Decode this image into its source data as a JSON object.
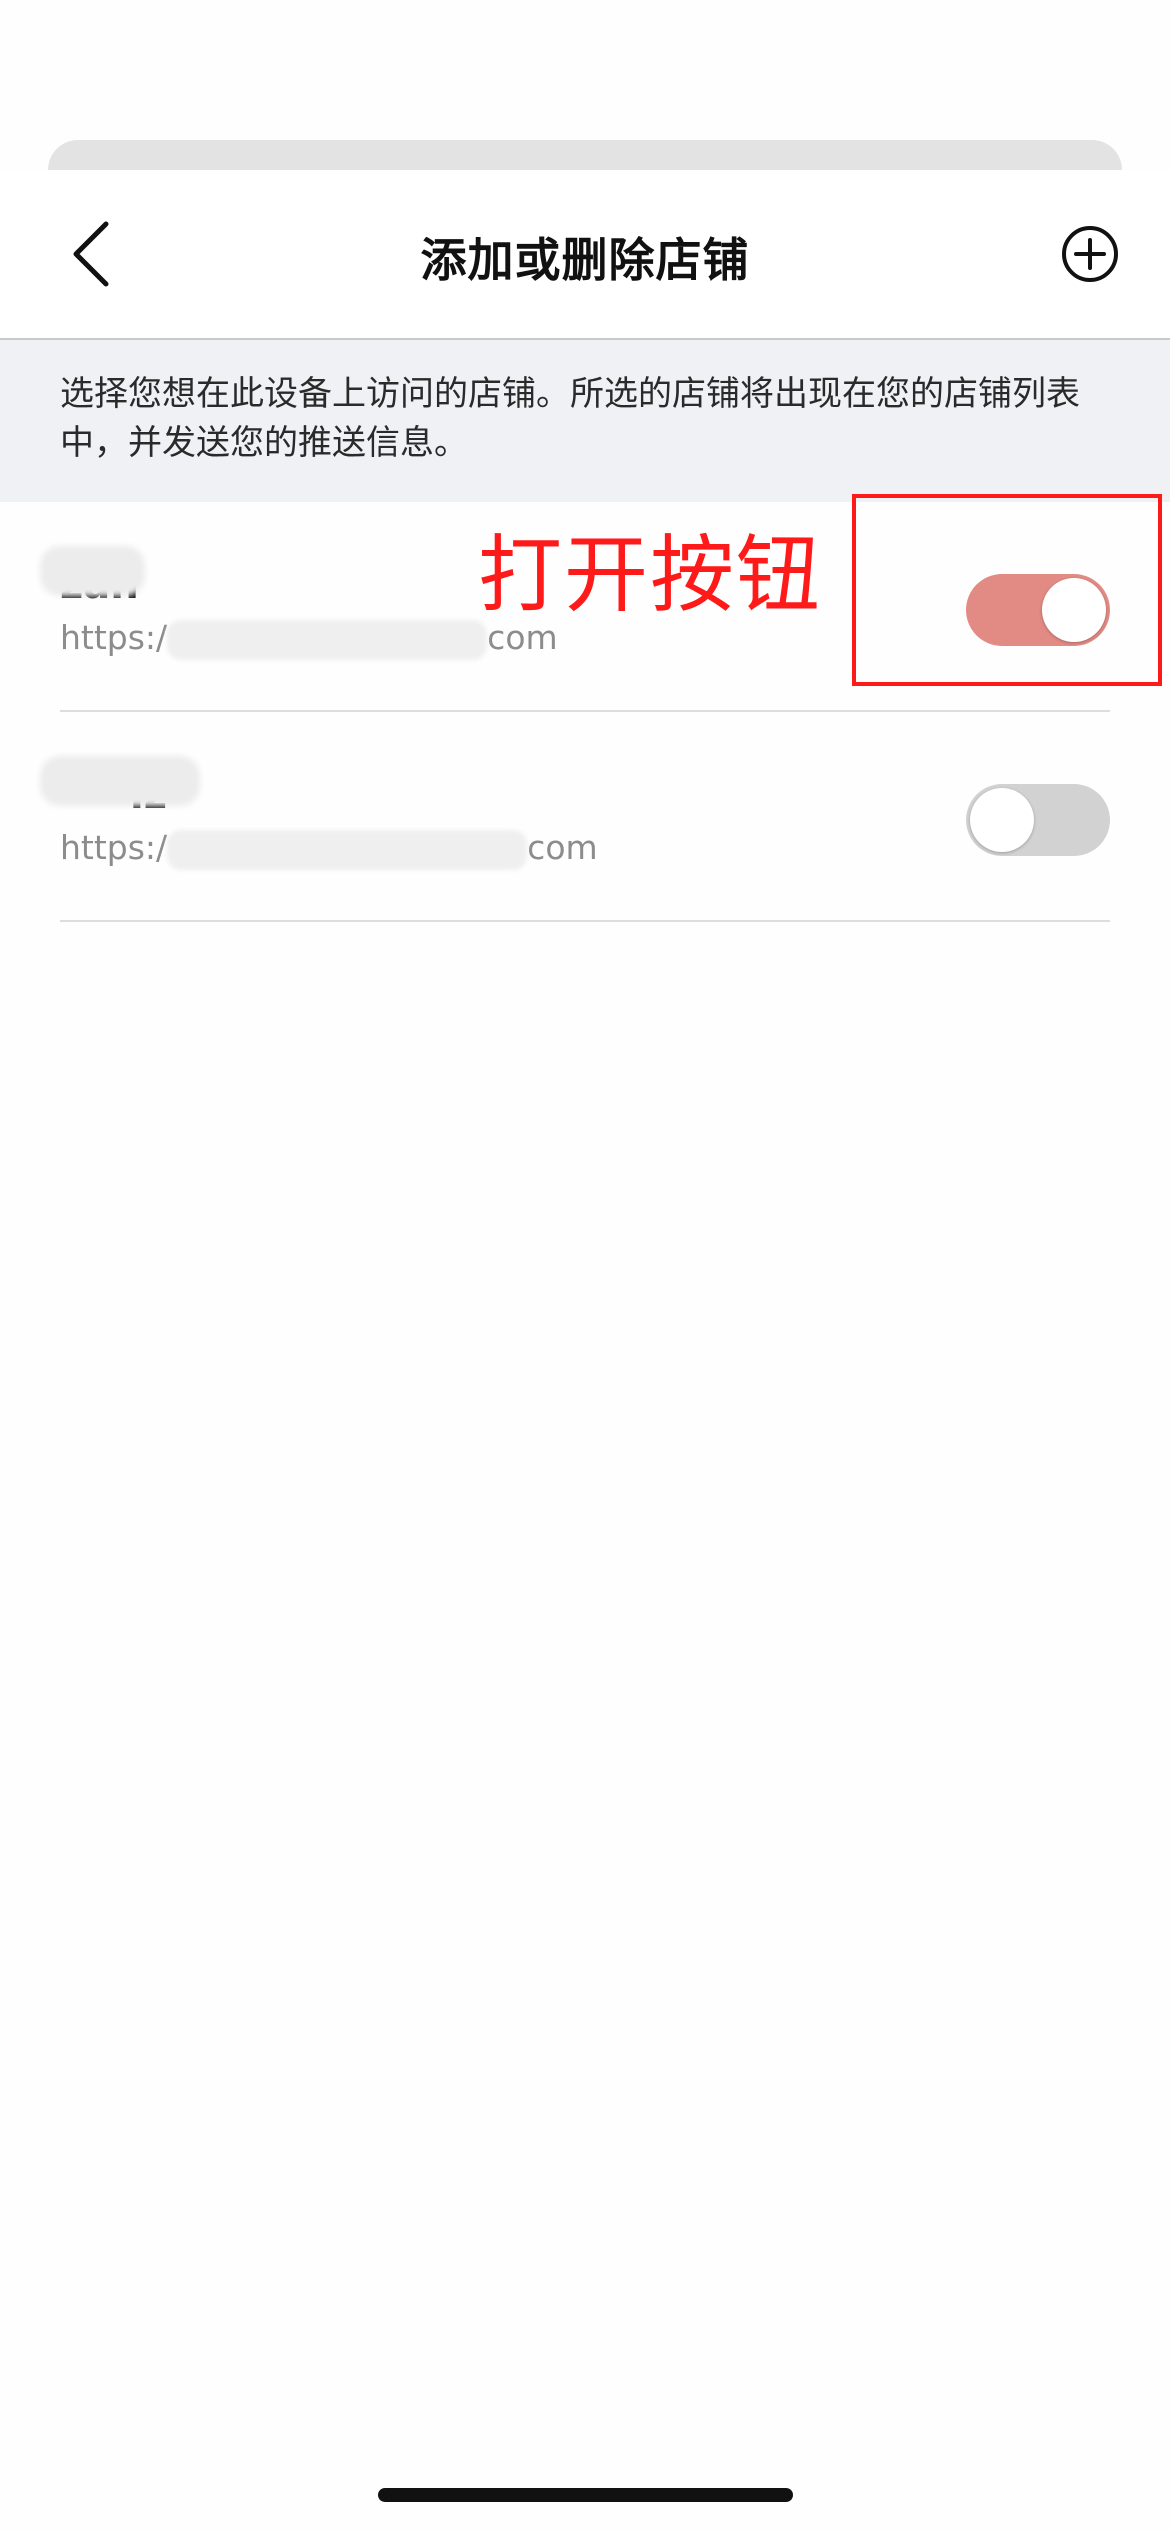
{
  "header": {
    "title": "添加或删除店铺",
    "back_icon": "chevron-left-icon",
    "add_icon": "plus-circle-icon"
  },
  "info": {
    "text": "选择您想在此设备上访问的店铺。所选的店铺将出现在您的店铺列表中，并发送您的推送信息。"
  },
  "stores": [
    {
      "name": "zan",
      "url_prefix": "https:/",
      "url_suffix": "com",
      "enabled": true
    },
    {
      "name": "iz",
      "url_prefix": "https:/",
      "url_suffix": "com",
      "enabled": false
    }
  ],
  "annotation": {
    "label": "打开按钮",
    "color": "#ff1a1a"
  },
  "colors": {
    "toggle_on": "#e28b85",
    "toggle_off": "#d2d2d2",
    "info_background": "#eff1f4"
  }
}
